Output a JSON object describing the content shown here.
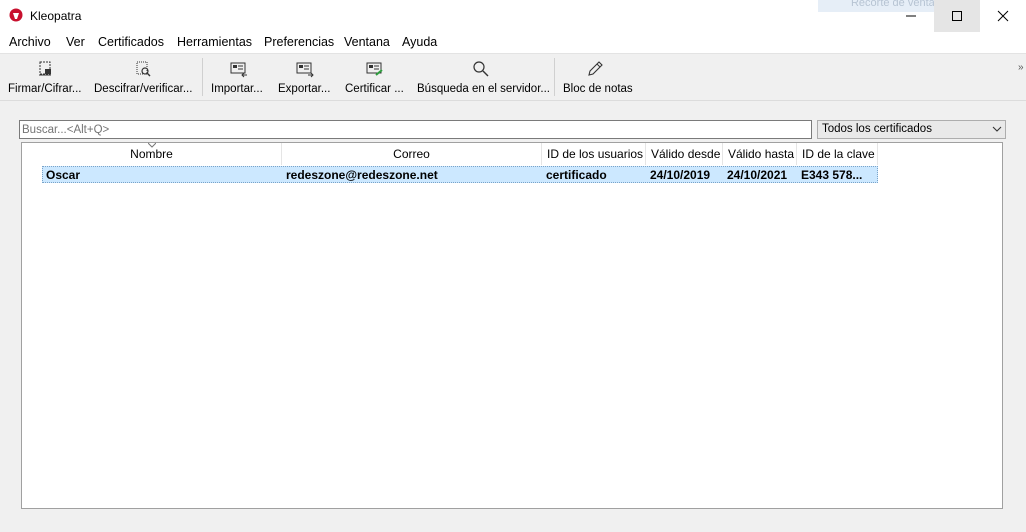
{
  "window": {
    "title": "Kleopatra",
    "snap_hint": "Recorte de ventana"
  },
  "menu": [
    "Archivo",
    "Ver",
    "Certificados",
    "Herramientas",
    "Preferencias",
    "Ventana",
    "Ayuda"
  ],
  "toolbar": {
    "sign_encrypt": "Firmar/Cifrar...",
    "decrypt_verify": "Descifrar/verificar...",
    "import": "Importar...",
    "export": "Exportar...",
    "certify": "Certificar ...",
    "server_search": "Búsqueda en el servidor...",
    "notepad": "Bloc de notas"
  },
  "search": {
    "placeholder": "Buscar...<Alt+Q>"
  },
  "filter": {
    "selected": "Todos los certificados"
  },
  "table": {
    "columns": [
      "Nombre",
      "Correo",
      "ID de los usuarios",
      "Válido desde",
      "Válido hasta",
      "ID de la clave"
    ],
    "rows": [
      {
        "name": "Oscar",
        "email": "redeszone@redeszone.net",
        "user_id": "certificado",
        "valid_from": "24/10/2019",
        "valid_until": "24/10/2021",
        "key_id": "E343 578..."
      }
    ]
  },
  "icons": {
    "app": "kleopatra-icon",
    "accent": "#c8102e"
  }
}
